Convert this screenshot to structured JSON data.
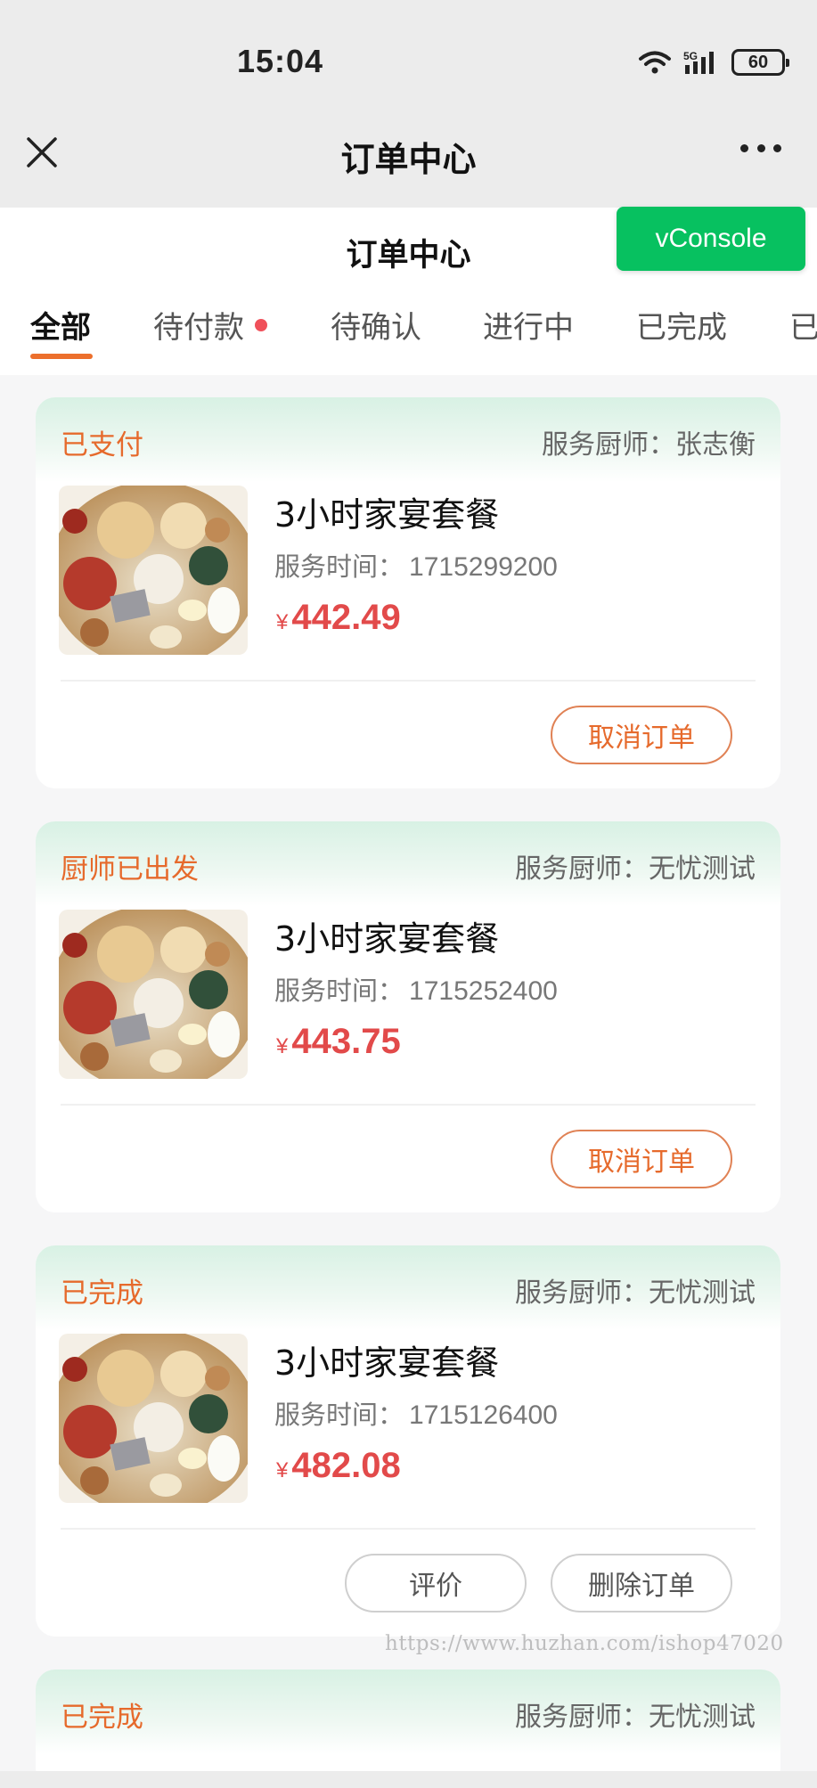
{
  "status_bar": {
    "time": "15:04",
    "network": "5G",
    "battery": "60"
  },
  "nav": {
    "title": "订单中心",
    "close_icon": "close-icon",
    "more_icon": "more-dots-icon"
  },
  "page": {
    "title": "订单中心",
    "vconsole": "vConsole"
  },
  "tabs": [
    {
      "label": "全部",
      "active": true
    },
    {
      "label": "待付款",
      "badge": true
    },
    {
      "label": "待确认"
    },
    {
      "label": "进行中"
    },
    {
      "label": "已完成"
    },
    {
      "label": "已"
    }
  ],
  "orders": [
    {
      "status": "已支付",
      "chef_label": "服务厨师：",
      "chef": "张志衡",
      "product": "3小时家宴套餐",
      "time_label": "服务时间：",
      "time": "1715299200",
      "currency": "¥",
      "price": "442.49",
      "buttons": [
        "取消订单"
      ]
    },
    {
      "status": "厨师已出发",
      "chef_label": "服务厨师：",
      "chef": "无忧测试",
      "product": "3小时家宴套餐",
      "time_label": "服务时间：",
      "time": "1715252400",
      "currency": "¥",
      "price": "443.75",
      "buttons": [
        "取消订单"
      ]
    },
    {
      "status": "已完成",
      "chef_label": "服务厨师：",
      "chef": "无忧测试",
      "product": "3小时家宴套餐",
      "time_label": "服务时间：",
      "time": "1715126400",
      "currency": "¥",
      "price": "482.08",
      "buttons": [
        "评价",
        "删除订单"
      ]
    },
    {
      "status": "已完成",
      "chef_label": "服务厨师：",
      "chef": "无忧测试"
    }
  ],
  "watermark": "https://www.huzhan.com/ishop47020",
  "colors": {
    "accent": "#e66a2c",
    "price": "#e24a4a",
    "vconsole": "#07c160",
    "card_head": "#d8f1e4"
  }
}
